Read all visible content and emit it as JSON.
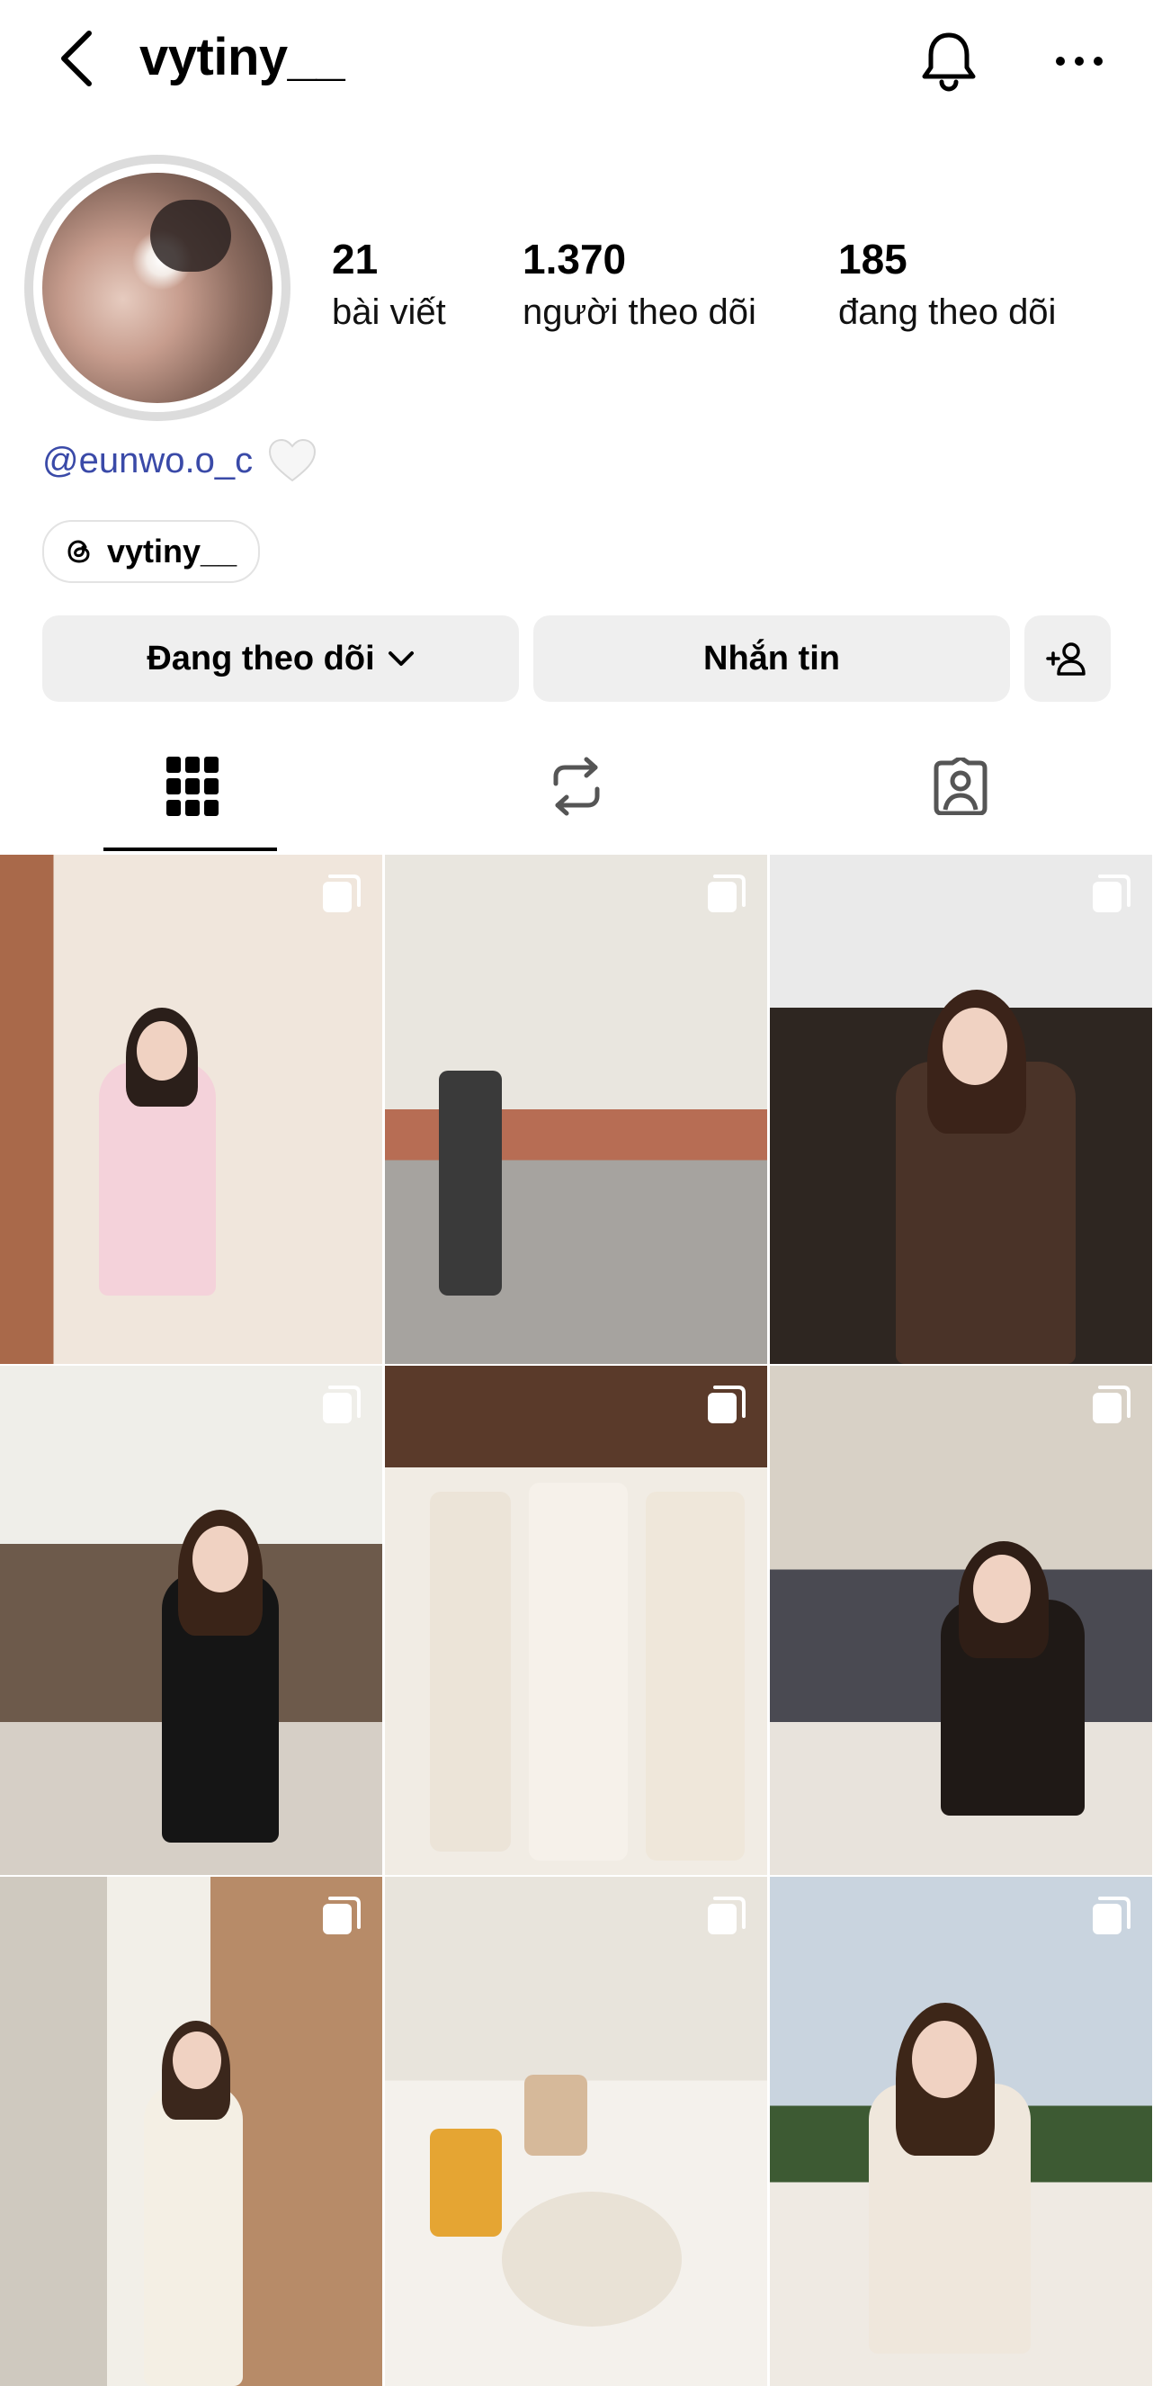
{
  "header": {
    "username": "vytiny__",
    "back_icon": "chevron-left-icon",
    "bell_icon": "bell-icon",
    "more_icon": "more-horizontal-icon"
  },
  "stats": {
    "posts": {
      "value": "21",
      "label": "bài viết"
    },
    "followers": {
      "value": "1.370",
      "label": "người theo dõi"
    },
    "following": {
      "value": "185",
      "label": "đang theo dõi"
    }
  },
  "bio": {
    "handle": "@eunwo.o_c",
    "emoji": "white-heart"
  },
  "threads": {
    "label": "vytiny__",
    "icon": "threads-icon"
  },
  "actions": {
    "following_label": "Đang theo dõi",
    "message_label": "Nhắn tin",
    "add_user_icon": "add-user-icon"
  },
  "tabs": [
    {
      "name": "posts",
      "icon": "grid-icon",
      "active": true
    },
    {
      "name": "reposts",
      "icon": "repost-icon",
      "active": false
    },
    {
      "name": "tagged",
      "icon": "tagged-icon",
      "active": false
    }
  ],
  "colors": {
    "link": "#3a4aa8",
    "button_bg": "#efefef"
  }
}
